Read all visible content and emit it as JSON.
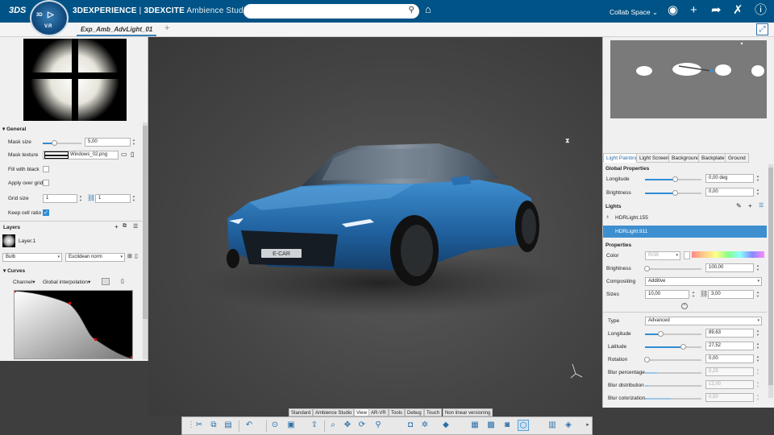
{
  "app": {
    "brand": "3DEXPERIENCE",
    "separator": "|",
    "product": "3DEXCITE",
    "product_sub": "Ambience Studio",
    "logo": "3DS",
    "compass": {
      "n3d": "3D",
      "v": "V.R",
      "play": "▷"
    }
  },
  "topbar": {
    "search_placeholder": "",
    "collab_space": "Collab Space",
    "icons": [
      "search-icon",
      "tag-icon",
      "user-icon",
      "add-icon",
      "share-icon",
      "tools-icon",
      "help-icon"
    ]
  },
  "tabs": {
    "active": "Exp_Amb_AdvLight_01",
    "add": "+"
  },
  "left": {
    "general": {
      "title": "General",
      "mask_size_label": "Mask size",
      "mask_size_value": "5,00",
      "mask_texture_label": "Mask texture",
      "mask_texture_file": "Windows_02.png",
      "fill_black_label": "Fill with black",
      "apply_grid_label": "Apply over grid",
      "grid_size_label": "Grid size",
      "grid_x": "1",
      "grid_y": "1",
      "keep_ratio_label": "Keep cell ratio"
    },
    "layers": {
      "title": "Layers",
      "layer_name": "Layer.1",
      "shape": "Bulb",
      "norm": "Euclidean norm"
    },
    "curves": {
      "title": "Curves",
      "channel": "Channel",
      "interp": "Global interpolation"
    }
  },
  "right": {
    "tabs": [
      "Light Painting",
      "Light Screen",
      "Background",
      "Backplate",
      "Ground"
    ],
    "global": {
      "title": "Global Properties",
      "longitude_label": "Longitude",
      "longitude_value": "0,00 deg",
      "brightness_label": "Brightness",
      "brightness_value": "0,00"
    },
    "lights": {
      "title": "Lights",
      "items": [
        "HDRLight.155",
        "HDRLight.911"
      ]
    },
    "props": {
      "title": "Properties",
      "color_label": "Color",
      "color_mode": "RGB",
      "brightness_label": "Brightness",
      "brightness_value": "100,00",
      "compositing_label": "Compositing",
      "compositing_value": "Additive",
      "sizes_label": "Sizes",
      "size_w": "10,00",
      "size_h": "3,00",
      "type_label": "Type",
      "type_value": "Advanced",
      "longitude_label": "Longitude",
      "longitude_value": "89,63",
      "latitude_label": "Latitude",
      "latitude_value": "27,52",
      "rotation_label": "Rotation",
      "rotation_value": "0,00",
      "blur_pct_label": "Blur percentage",
      "blur_pct_value": "0,25",
      "blur_dist_label": "Blur distribution",
      "blur_dist_value": "12,00",
      "blur_col_label": "Blur colorization",
      "blur_col_value": "0,50"
    },
    "sliders": {
      "g_long": 0.18,
      "g_bright": 0.18,
      "p_bright": 0.0,
      "p_long": 0.25,
      "p_lat": 0.62,
      "p_rot": 0.0,
      "p_blur_pct": 0.2,
      "p_blur_dist": 0.05,
      "p_blur_col": 0.45
    }
  },
  "scene": {
    "plate": "E-CAR"
  },
  "bottom": {
    "tabs": [
      "Standard",
      "Ambience Studio",
      "View",
      "AR-VR",
      "Tools",
      "Debug",
      "Touch",
      "Non linear versioning"
    ],
    "active": "View"
  },
  "colors": {
    "topbar": "#005386",
    "accent": "#2e8bd3",
    "selected": "#3d8fd0"
  }
}
